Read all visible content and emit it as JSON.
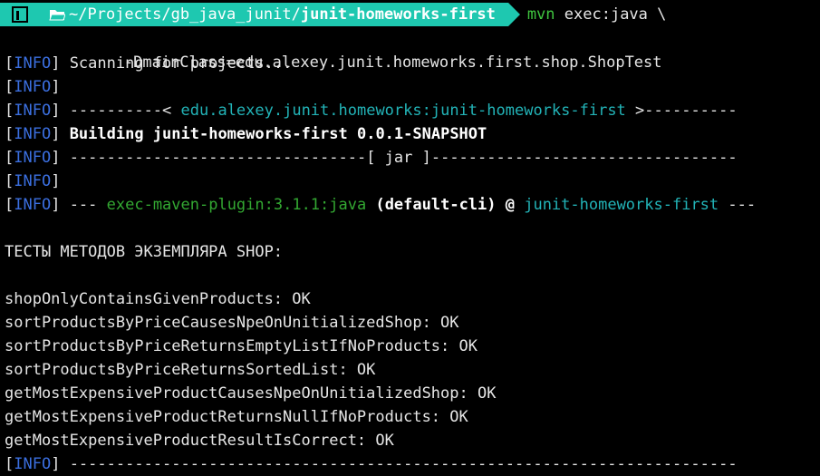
{
  "prompt": {
    "os_icon": "terminal-os-icon",
    "path_prefix": "~/Projects/gb_java_junit/",
    "path_current": "junit-homeworks-first",
    "cmd_name": "mvn",
    "cmd_args": "exec:java \\",
    "cmd_cont": "    -DmainClass=edu.alexey.junit.homeworks.first.shop.ShopTest"
  },
  "info_tag": "INFO",
  "maven": {
    "scanning": "Scanning for projects...",
    "dash_left": "----------< ",
    "artifact": "edu.alexey.junit.homeworks:junit-homeworks-first",
    "dash_right": " >----------",
    "building": "Building junit-homeworks-first 0.0.1-SNAPSHOT",
    "jar_line": "--------------------------------[ jar ]---------------------------------",
    "plugin_prefix": "--- ",
    "plugin": "exec-maven-plugin:3.1.1:java",
    "plugin_exec": " (default-cli) @ ",
    "plugin_project": "junit-homeworks-first",
    "plugin_suffix": " ---",
    "final_dashes": "------------------------------------------------------------------------"
  },
  "output": {
    "heading": "ТЕСТЫ МЕТОДОВ ЭКЗЕМПЛЯРА SHOP:",
    "results": [
      "shopOnlyContainsGivenProducts: OK",
      "sortProductsByPriceCausesNpeOnUnitializedShop: OK",
      "sortProductsByPriceReturnsEmptyListIfNoProducts: OK",
      "sortProductsByPriceReturnsSortedList: OK",
      "getMostExpensiveProductCausesNpeOnUnitializedShop: OK",
      "getMostExpensiveProductReturnsNullIfNoProducts: OK",
      "getMostExpensiveProductResultIsCorrect: OK"
    ]
  }
}
